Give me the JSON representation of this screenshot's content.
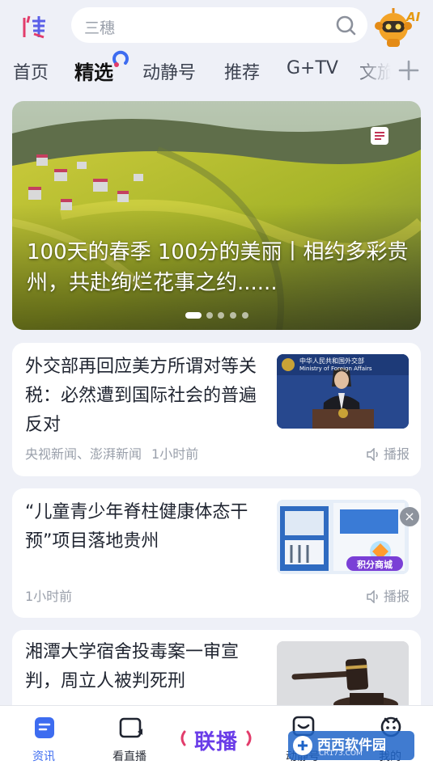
{
  "header": {
    "logo_icon": "app-logo-icon",
    "search_placeholder": "三穗",
    "search_icon": "search-icon",
    "assistant_label": "AI"
  },
  "tabs": [
    {
      "label": "首页",
      "active": false
    },
    {
      "label": "精选",
      "active": true
    },
    {
      "label": "动静号",
      "active": false
    },
    {
      "label": "推荐",
      "active": false
    },
    {
      "label": "G+TV",
      "active": false
    },
    {
      "label": "文旅",
      "active": false
    }
  ],
  "banner": {
    "title": "100天的春季 100分的美丽丨相约多彩贵州，共赴绚烂花事之约......",
    "slide_count": 5,
    "active_slide": 1
  },
  "articles": [
    {
      "title": "外交部再回应美方所谓对等关税：必然遭到国际社会的普遍反对",
      "source": "央视新闻、澎湃新闻",
      "time": "1小时前",
      "listen_label": "播报",
      "thumb_caption": "中华人民共和国外交部",
      "thumb_caption_en": "Ministry of Foreign Affairs"
    },
    {
      "title": "“儿童青少年脊柱健康体态干预”项目落地贵州",
      "source": "",
      "time": "1小时前",
      "listen_label": "播报",
      "ad_label": "积分商城"
    },
    {
      "title": "湘潭大学宿舍投毒案一审宣判，周立人被判死刑",
      "source": "",
      "time": "",
      "listen_label": ""
    }
  ],
  "bottom_nav": [
    {
      "label": "资讯",
      "icon": "news-icon",
      "active": true
    },
    {
      "label": "看直播",
      "icon": "live-tv-icon",
      "active": false
    },
    {
      "label": "联播",
      "icon": "broadcast-logo",
      "active": false
    },
    {
      "label": "动静号",
      "icon": "dongjing-icon",
      "active": false
    },
    {
      "label": "我的",
      "icon": "profile-icon",
      "active": false
    }
  ],
  "watermark": {
    "text": "西西软件园",
    "sub": "CR173.COM"
  },
  "colors": {
    "accent": "#3d6cf0",
    "live_brand": "#6a3de8",
    "background": "#eef0f7"
  }
}
